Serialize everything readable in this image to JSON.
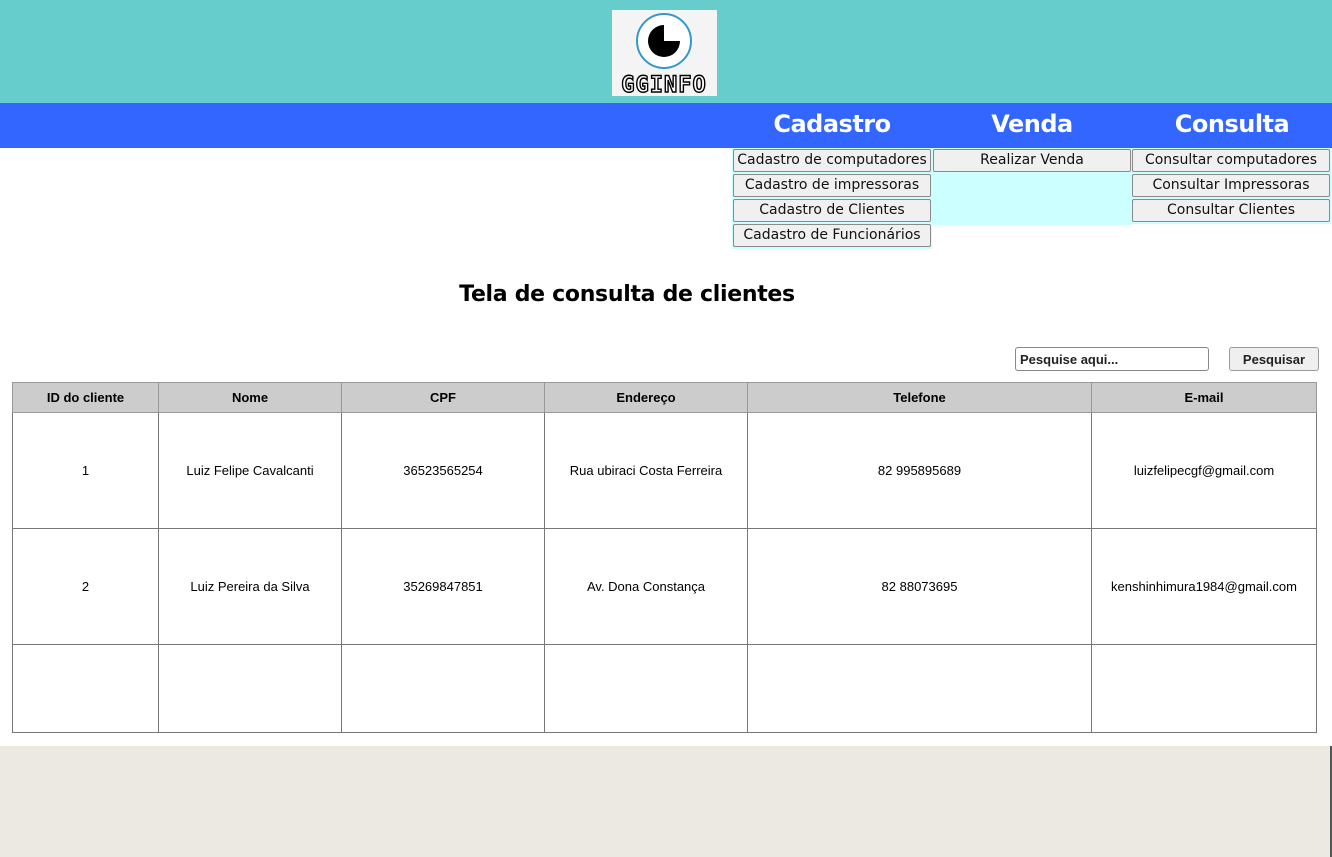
{
  "header": {
    "logo_text": "GGINFO",
    "background": "#66cccc"
  },
  "nav": {
    "background": "#3366ff",
    "menus": [
      {
        "title": "Cadastro",
        "items": [
          "Cadastro de computadores",
          "Cadastro de impressoras",
          "Cadastro de Clientes",
          "Cadastro de Funcionários"
        ]
      },
      {
        "title": "Venda",
        "items": [
          "Realizar Venda"
        ]
      },
      {
        "title": "Consulta",
        "items": [
          "Consultar computadores",
          "Consultar Impressoras",
          "Consultar Clientes"
        ]
      }
    ]
  },
  "page": {
    "title": "Tela de consulta de clientes"
  },
  "search": {
    "placeholder": "Pesquise aqui...",
    "button_label": "Pesquisar"
  },
  "table": {
    "columns": [
      "ID do cliente",
      "Nome",
      "CPF",
      "Endereço",
      "Telefone",
      "E-mail"
    ],
    "rows": [
      [
        "1",
        "Luiz Felipe Cavalcanti",
        "36523565254",
        "Rua ubiraci Costa Ferreira",
        "82 995895689",
        "luizfelipecgf@gmail.com"
      ],
      [
        "2",
        "Luiz Pereira da Silva",
        "35269847851",
        "Av. Dona Constança",
        "82 88073695",
        "kenshinhimura1984@gmail.com"
      ],
      [
        "",
        "",
        "",
        "",
        "",
        ""
      ]
    ]
  }
}
